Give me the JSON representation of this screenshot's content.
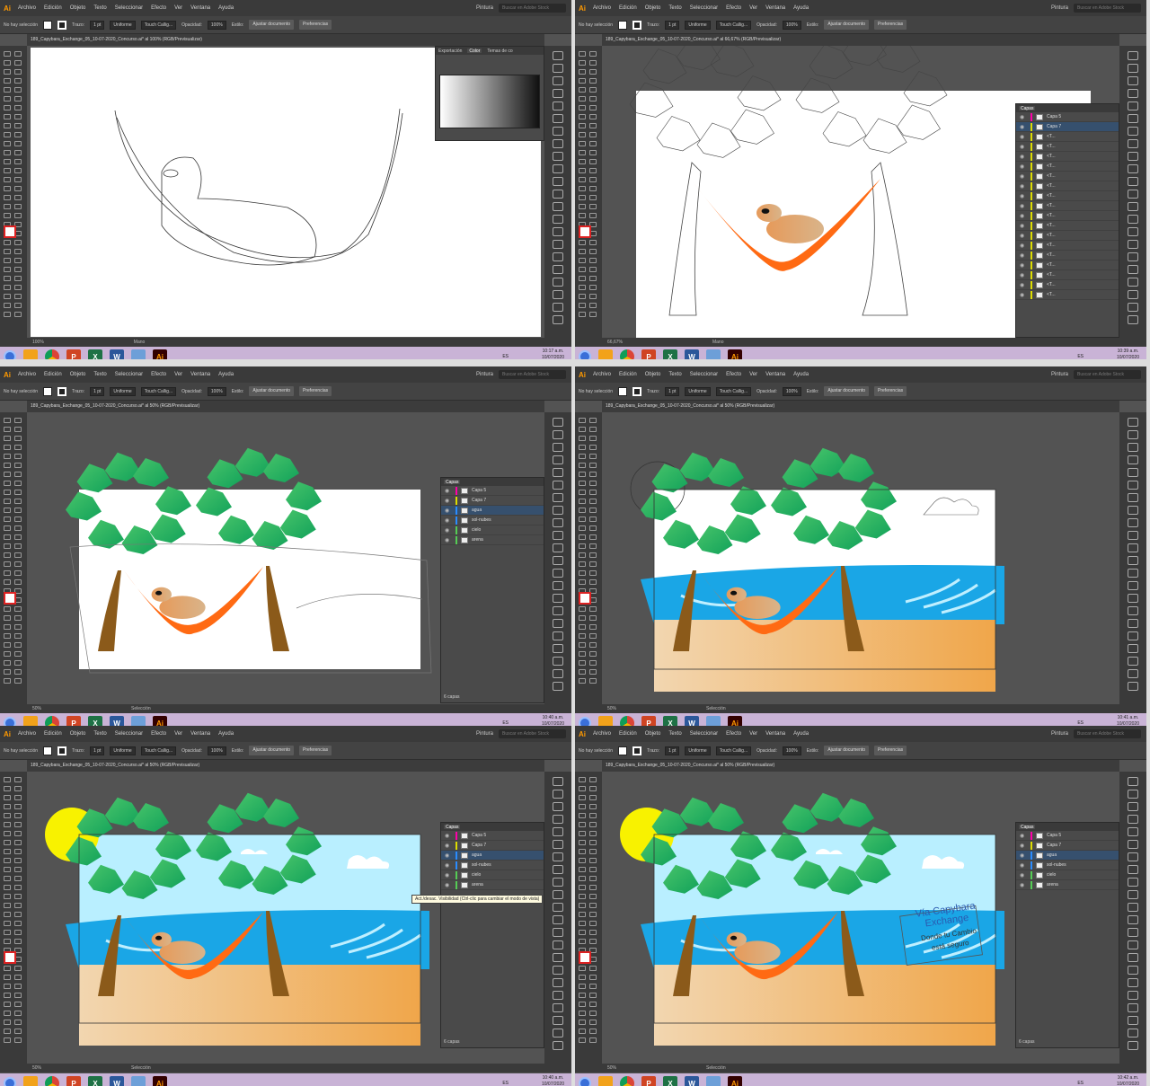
{
  "app": {
    "logo": "Ai",
    "menu": [
      "Archivo",
      "Edición",
      "Objeto",
      "Texto",
      "Seleccionar",
      "Efecto",
      "Ver",
      "Ventana",
      "Ayuda"
    ],
    "workspace": "Pintura",
    "search_placeholder": "Buscar en Adobe Stock",
    "ctrl": {
      "no_selection": "No hay selección",
      "trazo": "Trazo:",
      "stroke_weight": "1 pt",
      "uniform": "Uniforme",
      "brush": "Touch Callig...",
      "opacity_label": "Opacidad:",
      "opacity": "100%",
      "style_label": "Estilo:",
      "adjust_doc": "Ajustar documento",
      "prefs": "Preferencias"
    }
  },
  "taskbar": {
    "lang": "ES",
    "date": "10/07/2020",
    "apps": [
      {
        "name": "media-player",
        "label": "",
        "color": "#f2a21a"
      },
      {
        "name": "chrome",
        "label": "",
        "color": "#db4437"
      },
      {
        "name": "powerpoint",
        "label": "P",
        "color": "#d04423"
      },
      {
        "name": "excel",
        "label": "X",
        "color": "#1e7145"
      },
      {
        "name": "word",
        "label": "W",
        "color": "#2b579a"
      },
      {
        "name": "notepad",
        "label": "",
        "color": "#6d9fd8"
      },
      {
        "name": "illustrator",
        "label": "Ai",
        "color": "#330000"
      }
    ]
  },
  "colors": {
    "orange": "#ff6a13",
    "leaf": "#12a25a",
    "leaf_light": "#48c46a",
    "trunk": "#8b5a1a",
    "sky": "#b9efff",
    "water": "#1aa6e6",
    "sand": "#f0c488",
    "sun": "#f8f200",
    "capy": "#e8a366"
  },
  "panels": [
    {
      "tab": "189_Capybara_Exchange_05_10-07-2020_Concurso.ai* al 100% (RGB/Previsualizar)",
      "zoom": "100%",
      "tool": "Mano",
      "time": "10:17 a.m.",
      "color_panel_tabs": [
        "Exportación",
        "Color",
        "Temas de co"
      ]
    },
    {
      "tab": "189_Capybara_Exchange_05_10-07-2020_Concurso.ai* al 66,67% (RGB/Previsualizar)",
      "zoom": "66,67%",
      "tool": "Mano",
      "time": "10:39 a.m.",
      "layers_count": "6 capas",
      "layers": [
        "Capa 5",
        "Capa 7",
        "<T...",
        "<T...",
        "<T...",
        "<T...",
        "<T...",
        "<T...",
        "<T...",
        "<T...",
        "<T...",
        "<T...",
        "<T...",
        "<T...",
        "<T...",
        "<T...",
        "<T...",
        "<T...",
        "<T..."
      ]
    },
    {
      "tab": "189_Capybara_Exchange_05_10-07-2020_Concurso.ai* al 50% (RGB/Previsualizar)",
      "zoom": "50%",
      "tool": "Selección",
      "time": "10:40 a.m.",
      "layers_count": "6 capas",
      "layers": [
        "Capa 5",
        "Capa 7",
        "agua",
        "sol-nubes",
        "cielo",
        "arena"
      ]
    },
    {
      "tab": "189_Capybara_Exchange_05_10-07-2020_Concurso.ai* al 50% (RGB/Previsualizar)",
      "zoom": "50%",
      "tool": "Selección",
      "time": "10:41 a.m."
    },
    {
      "tab": "189_Capybara_Exchange_05_10-07-2020_Concurso.ai* al 50% (RGB/Previsualizar)",
      "zoom": "50%",
      "tool": "Selección",
      "time": "10:40 a.m.",
      "layers_count": "6 capas",
      "layers": [
        "Capa 5",
        "Capa 7",
        "agua",
        "sol-nubes",
        "cielo",
        "arena"
      ],
      "tooltip": "Act./desac. Visibilidad (Ctrl-clic para cambiar el modo de vista)"
    },
    {
      "tab": "189_Capybara_Exchange_05_10-07-2020_Concurso.ai* al 50% (RGB/Previsualizar)",
      "zoom": "50%",
      "tool": "Selección",
      "time": "10:42 a.m.",
      "layers_count": "6 capas",
      "layers": [
        "Capa 5",
        "Capa 7",
        "agua",
        "sol-nubes",
        "cielo",
        "arena"
      ],
      "stamp_line1": "Vía Capybara",
      "stamp_line2": "Exchange",
      "stamp_line3": "Donde tu Cambio",
      "stamp_line4": "está seguro"
    }
  ]
}
